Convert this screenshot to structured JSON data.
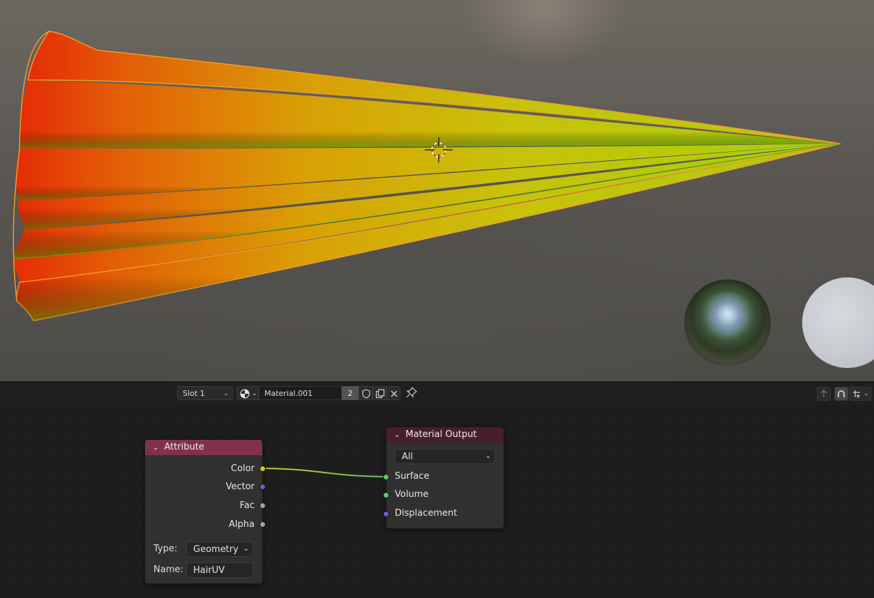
{
  "header": {
    "slot_label": "Slot 1",
    "material_name": "Material.001",
    "user_count": "2",
    "icons": [
      "material-sphere-icon",
      "fake-user-shield-icon",
      "duplicate-icon",
      "unlink-x-icon",
      "pin-icon",
      "parent-arrow-icon",
      "snap-icon",
      "transform-icon"
    ]
  },
  "nodes": {
    "attribute": {
      "title": "Attribute",
      "outputs": [
        "Color",
        "Vector",
        "Fac",
        "Alpha"
      ],
      "type_label": "Type:",
      "type_value": "Geometry",
      "name_label": "Name:",
      "name_value": "HairUV",
      "header_color": "#83314a"
    },
    "material_output": {
      "title": "Material Output",
      "target": "All",
      "inputs": [
        "Surface",
        "Volume",
        "Displacement"
      ],
      "header_color": "#481e2a"
    }
  },
  "colors": {
    "socket_color": "#c7c729",
    "socket_vector": "#6363c7",
    "socket_float": "#a1a1a1",
    "socket_shader": "#63c763",
    "selection_outline": "#f59a23"
  }
}
